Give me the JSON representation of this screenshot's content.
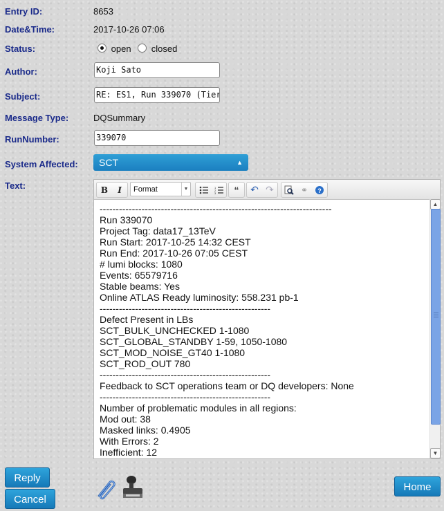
{
  "fields": {
    "entry_id_label": "Entry ID:",
    "entry_id_value": "8653",
    "datetime_label": "Date&Time:",
    "datetime_value": "2017-10-26 07:06",
    "status_label": "Status:",
    "status_open": "open",
    "status_closed": "closed",
    "status_selected": "open",
    "author_label": "Author:",
    "author_value": "Koji Sato",
    "subject_label": "Subject:",
    "subject_value": "RE: ES1, Run 339070 (Tier-",
    "message_type_label": "Message Type:",
    "message_type_value": "DQSummary",
    "runnumber_label": "RunNumber:",
    "runnumber_value": "339070",
    "system_label": "System Affected:",
    "system_value": "SCT",
    "text_label": "Text:"
  },
  "editor": {
    "format_label": "Format",
    "lines": [
      "------------------------------------------------------------------------",
      "Run 339070",
      "Project Tag: data17_13TeV",
      "Run Start: 2017-10-25 14:32 CEST",
      "Run End: 2017-10-26 07:05 CEST",
      "# lumi blocks: 1080",
      "Events: 65579716",
      "Stable beams: Yes",
      "Online ATLAS Ready luminosity: 558.231 pb-1",
      "-----------------------------------------------------",
      "Defect Present in LBs",
      "SCT_BULK_UNCHECKED 1-1080",
      "SCT_GLOBAL_STANDBY 1-59, 1050-1080",
      "SCT_MOD_NOISE_GT40 1-1080",
      "SCT_ROD_OUT 780",
      "-----------------------------------------------------",
      "Feedback to SCT operations team or DQ developers: None",
      "-----------------------------------------------------",
      "Number of problematic modules in all regions:",
      "Mod out: 38",
      "Masked links: 0.4905",
      "With Errors: 2",
      "Inefficient: 12"
    ]
  },
  "buttons": {
    "reply": "Reply",
    "cancel": "Cancel",
    "home": "Home"
  },
  "colors": {
    "label": "#1a2a8a",
    "button": "#1f8bc9",
    "scroll_thumb": "#7aa4e6"
  },
  "icons": [
    "paperclip-icon",
    "stamp-icon",
    "bold-icon",
    "italic-icon",
    "bulleted-list-icon",
    "numbered-list-icon",
    "blockquote-icon",
    "undo-icon",
    "redo-icon",
    "find-replace-icon",
    "link-icon",
    "help-icon"
  ]
}
